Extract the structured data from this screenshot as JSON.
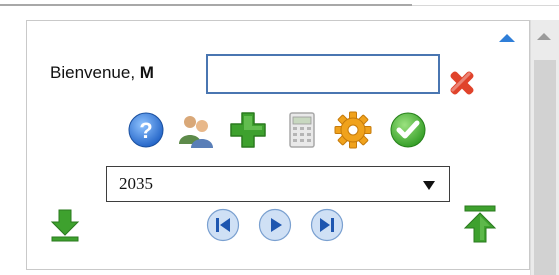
{
  "header": {
    "welcome_text": "Bienvenue, ",
    "user_initial": "M"
  },
  "name_input": {
    "value": "",
    "placeholder": ""
  },
  "toolbar": {
    "icons": [
      "help-icon",
      "users-icon",
      "add-icon",
      "calculator-icon",
      "settings-icon",
      "check-icon"
    ]
  },
  "year_select": {
    "selected": "2035"
  },
  "navigation": {
    "icons": [
      "first-page-icon",
      "play-icon",
      "last-page-icon"
    ]
  },
  "colors": {
    "accent": "#2f7ed8",
    "input_border": "#4a76b1",
    "delete_red": "#e0432b",
    "green": "#3ea12e"
  }
}
